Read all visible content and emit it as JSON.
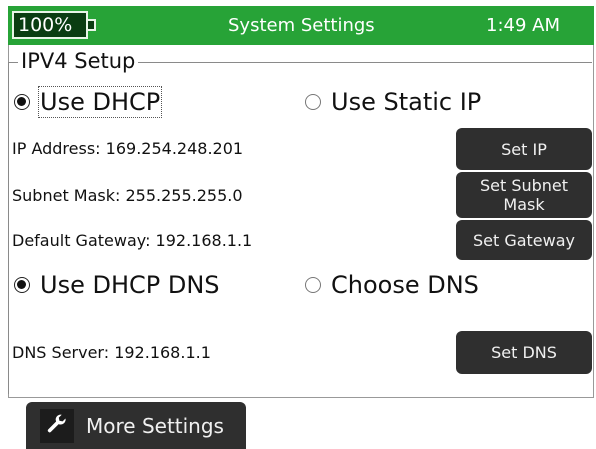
{
  "status_bar": {
    "battery": "100%",
    "title": "System Settings",
    "time": "1:49 AM"
  },
  "ipv4": {
    "group_title": "IPV4 Setup",
    "mode_options": [
      {
        "label": "Use DHCP",
        "selected": true
      },
      {
        "label": "Use Static IP",
        "selected": false
      }
    ],
    "ip_address": "IP Address: 169.254.248.201",
    "subnet_mask": "Subnet Mask: 255.255.255.0",
    "default_gateway": "Default Gateway: 192.168.1.1",
    "set_ip_label": "Set IP",
    "set_subnet_label": "Set Subnet Mask",
    "set_gateway_label": "Set Gateway",
    "dns_options": [
      {
        "label": "Use DHCP DNS",
        "selected": true
      },
      {
        "label": "Choose DNS",
        "selected": false
      }
    ],
    "dns_server": "DNS Server: 192.168.1.1",
    "set_dns_label": "Set DNS"
  },
  "footer": {
    "more_settings_label": "More Settings",
    "more_settings_icon": "wrench-icon"
  },
  "colors": {
    "status_bar": "#27a337",
    "button": "#2f2f2f"
  }
}
